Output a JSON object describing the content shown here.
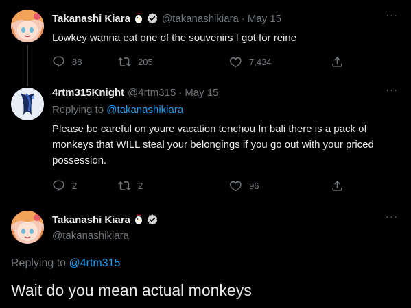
{
  "tweets": [
    {
      "name": "Takanashi Kiara",
      "handle": "@takanashikiara",
      "dot": "·",
      "date": "May 15",
      "text": "Lowkey wanna eat one of the souvenirs I got for reine",
      "replies": "88",
      "retweets": "205",
      "likes": "7,434"
    },
    {
      "name": "4rtm315Knight",
      "handle": "@4rtm315",
      "dot": "·",
      "date": "May 15",
      "replying_prefix": "Replying to ",
      "replying_to": "@takanashikiara",
      "text": "Please be careful on youre vacation tenchou In bali there is a pack of monkeys that WILL steal your belongings if you go out with your priced possession.",
      "replies": "2",
      "retweets": "2",
      "likes": "96"
    },
    {
      "name": "Takanashi Kiara",
      "handle": "@takanashikiara",
      "replying_prefix": "Replying to ",
      "replying_to": "@4rtm315",
      "text": "Wait do you mean actual monkeys"
    }
  ],
  "icons": {
    "more": "more-icon",
    "reply": "reply-icon",
    "retweet": "retweet-icon",
    "like": "like-icon",
    "share": "share-icon",
    "verified": "verified-badge-icon",
    "chicken": "chicken-emoji-icon"
  },
  "more_label": "···",
  "colors": {
    "background": "#000000",
    "text": "#e7e9ea",
    "muted": "#71767b",
    "accent": "#1d9bf0"
  }
}
